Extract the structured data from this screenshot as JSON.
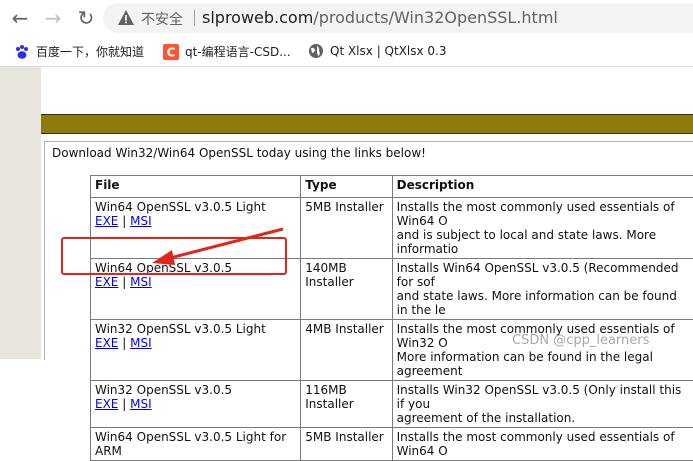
{
  "browser": {
    "address_insecure_label": "不安全",
    "url_domain": "slproweb.com",
    "url_path": "/products/Win32OpenSSL.html",
    "bookmarks": [
      {
        "label": "百度一下，你就知道",
        "icon": "baidu-paw-icon"
      },
      {
        "label": "qt-编程语言-CSD...",
        "icon": "csdn-c-icon"
      },
      {
        "label": "Qt Xlsx | QtXlsx 0.3",
        "icon": "globe-icon"
      }
    ]
  },
  "page": {
    "intro": "Download Win32/Win64 OpenSSL today using the links below!",
    "headers": {
      "file": "File",
      "type": "Type",
      "description": "Description"
    },
    "link_exe": "EXE",
    "link_msi": "MSI",
    "link_sep": "|",
    "rows": [
      {
        "file": "Win64 OpenSSL v3.0.5 Light",
        "type": "5MB Installer",
        "desc1": "Installs the most commonly used essentials of Win64 O",
        "desc2": "and is subject to local and state laws. More informatio"
      },
      {
        "file": "Win64 OpenSSL v3.0.5",
        "type": "140MB Installer",
        "desc1": "Installs Win64 OpenSSL v3.0.5 (Recommended for sof",
        "desc2": "and state laws. More information can be found in the le"
      },
      {
        "file": "Win32 OpenSSL v3.0.5 Light",
        "type": "4MB Installer",
        "desc1": "Installs the most commonly used essentials of Win32 O",
        "desc2": "More information can be found in the legal agreement "
      },
      {
        "file": "Win32 OpenSSL v3.0.5",
        "type": "116MB Installer",
        "desc1": "Installs Win32 OpenSSL v3.0.5 (Only install this if you",
        "desc2": "agreement of the installation."
      },
      {
        "file": "Win64 OpenSSL v3.0.5 Light for ARM",
        "type": "5MB Installer",
        "desc1": "Installs the most commonly used essentials of Win64 O",
        "desc2": ""
      }
    ]
  },
  "watermark": "CSDN @cpp_learners",
  "colors": {
    "olive_bar": "#8f7a0e",
    "annotation_red": "#e1251b",
    "link": "#0000ee"
  }
}
